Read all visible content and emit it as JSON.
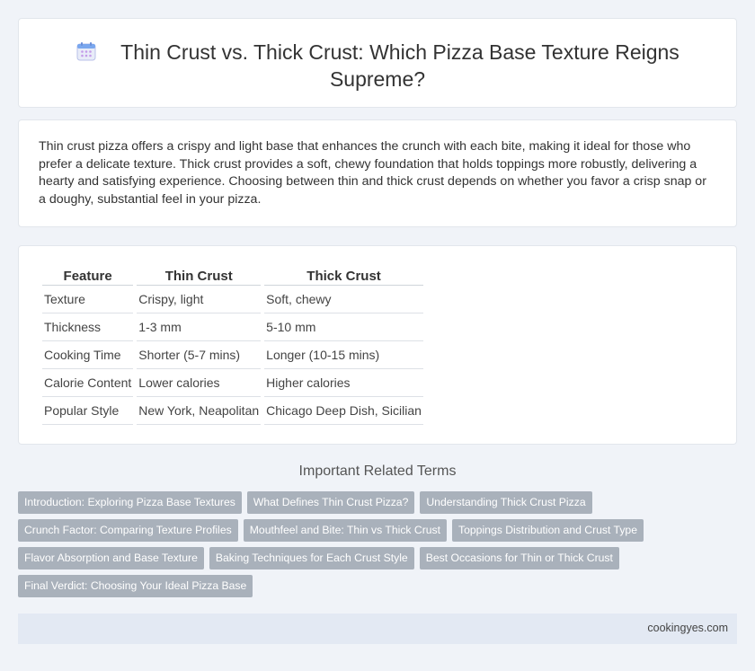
{
  "header": {
    "icon": "calendar-icon",
    "title": "Thin Crust vs. Thick Crust: Which Pizza Base Texture Reigns Supreme?"
  },
  "intro": {
    "text": "Thin crust pizza offers a crispy and light base that enhances the crunch with each bite, making it ideal for those who prefer a delicate texture. Thick crust provides a soft, chewy foundation that holds toppings more robustly, delivering a hearty and satisfying experience. Choosing between thin and thick crust depends on whether you favor a crisp snap or a doughy, substantial feel in your pizza."
  },
  "table": {
    "headers": [
      "Feature",
      "Thin Crust",
      "Thick Crust"
    ],
    "rows": [
      [
        "Texture",
        "Crispy, light",
        "Soft, chewy"
      ],
      [
        "Thickness",
        "1-3 mm",
        "5-10 mm"
      ],
      [
        "Cooking Time",
        "Shorter (5-7 mins)",
        "Longer (10-15 mins)"
      ],
      [
        "Calorie Content",
        "Lower calories",
        "Higher calories"
      ],
      [
        "Popular Style",
        "New York, Neapolitan",
        "Chicago Deep Dish, Sicilian"
      ]
    ]
  },
  "related": {
    "title": "Important Related Terms",
    "rows": [
      [
        "Introduction: Exploring Pizza Base Textures",
        "What Defines Thin Crust Pizza?",
        "Understanding Thick Crust Pizza"
      ],
      [
        "Crunch Factor: Comparing Texture Profiles",
        "Mouthfeel and Bite: Thin vs Thick Crust",
        "Toppings Distribution and Crust Type"
      ],
      [
        "Flavor Absorption and Base Texture",
        "Baking Techniques for Each Crust Style",
        "Best Occasions for Thin or Thick Crust"
      ],
      [
        "Final Verdict: Choosing Your Ideal Pizza Base"
      ]
    ]
  },
  "footer": {
    "site": "cookingyes.com"
  },
  "colors": {
    "background": "#f0f3f8",
    "tag": "#a9b1bb",
    "footer": "#e3e9f3"
  }
}
